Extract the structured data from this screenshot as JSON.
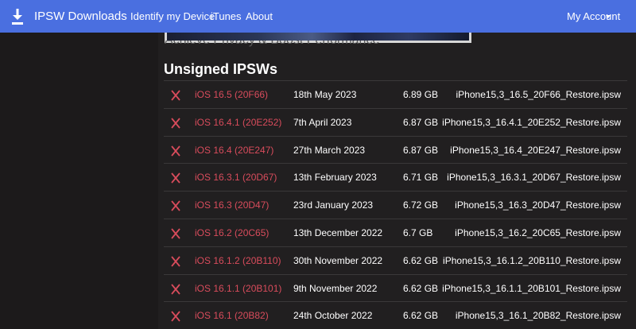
{
  "navbar": {
    "brand": "IPSW Downloads",
    "links": [
      "Identify my Device",
      "iTunes",
      "About"
    ],
    "account": "My Account"
  },
  "banner": {
    "text": "Achieve Privacy & Boost Performance"
  },
  "section": {
    "title": "Unsigned IPSWs"
  },
  "rows": [
    {
      "version": "iOS 16.5 (20F66)",
      "date": "18th May 2023",
      "size": "6.89 GB",
      "file": "iPhone15,3_16.5_20F66_Restore.ipsw"
    },
    {
      "version": "iOS 16.4.1 (20E252)",
      "date": "7th April 2023",
      "size": "6.87 GB",
      "file": "iPhone15,3_16.4.1_20E252_Restore.ipsw"
    },
    {
      "version": "iOS 16.4 (20E247)",
      "date": "27th March 2023",
      "size": "6.87 GB",
      "file": "iPhone15,3_16.4_20E247_Restore.ipsw"
    },
    {
      "version": "iOS 16.3.1 (20D67)",
      "date": "13th February 2023",
      "size": "6.71 GB",
      "file": "iPhone15,3_16.3.1_20D67_Restore.ipsw"
    },
    {
      "version": "iOS 16.3 (20D47)",
      "date": "23rd January 2023",
      "size": "6.72 GB",
      "file": "iPhone15,3_16.3_20D47_Restore.ipsw"
    },
    {
      "version": "iOS 16.2 (20C65)",
      "date": "13th December 2022",
      "size": "6.7 GB",
      "file": "iPhone15,3_16.2_20C65_Restore.ipsw"
    },
    {
      "version": "iOS 16.1.2 (20B110)",
      "date": "30th November 2022",
      "size": "6.62 GB",
      "file": "iPhone15,3_16.1.2_20B110_Restore.ipsw"
    },
    {
      "version": "iOS 16.1.1 (20B101)",
      "date": "9th November 2022",
      "size": "6.62 GB",
      "file": "iPhone15,3_16.1.1_20B101_Restore.ipsw"
    },
    {
      "version": "iOS 16.1 (20B82)",
      "date": "24th October 2022",
      "size": "6.62 GB",
      "file": "iPhone15,3_16.1_20B82_Restore.ipsw"
    }
  ],
  "icons": {
    "brand": "download-icon",
    "unsigned": "x-mark-icon",
    "account_menu": "caret-down-icon"
  },
  "colors": {
    "navbar": "#4a6fe0",
    "background": "#1c1a1b",
    "panel": "#211f20",
    "unsigned_red": "#d94c5c",
    "link_red": "#d94c5c"
  }
}
